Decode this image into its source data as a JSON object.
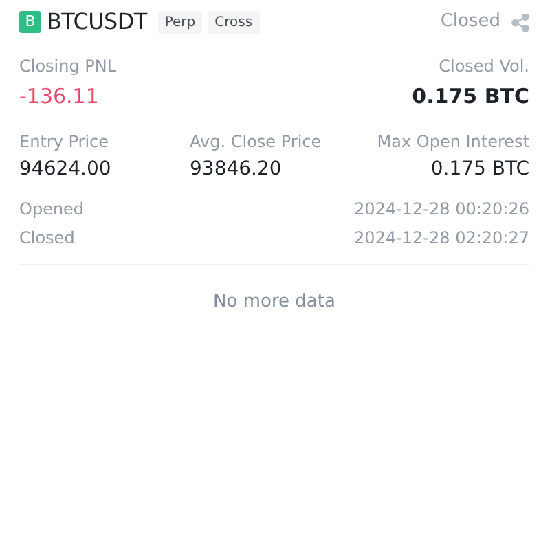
{
  "position": {
    "side_badge": "B",
    "color": "#2ebd85",
    "symbol": "BTCUSDT",
    "tags": [
      "Perp",
      "Cross"
    ],
    "status": "Closed"
  },
  "summary": [
    {
      "label": "Closing PNL",
      "value": "-136.11",
      "loss": true
    },
    {
      "label": "Closed Vol.",
      "value": "0.175 BTC",
      "loss": false
    }
  ],
  "prices": [
    {
      "label": "Entry Price",
      "value": "94624.00"
    },
    {
      "label": "Avg. Close Price",
      "value": "93846.20"
    },
    {
      "label": "Max Open Interest",
      "value": "0.175 BTC"
    }
  ],
  "times": [
    {
      "label": "Opened",
      "value": "2024-12-28 00:20:26"
    },
    {
      "label": "Closed",
      "value": "2024-12-28 02:20:27"
    }
  ],
  "footer": "No more data"
}
